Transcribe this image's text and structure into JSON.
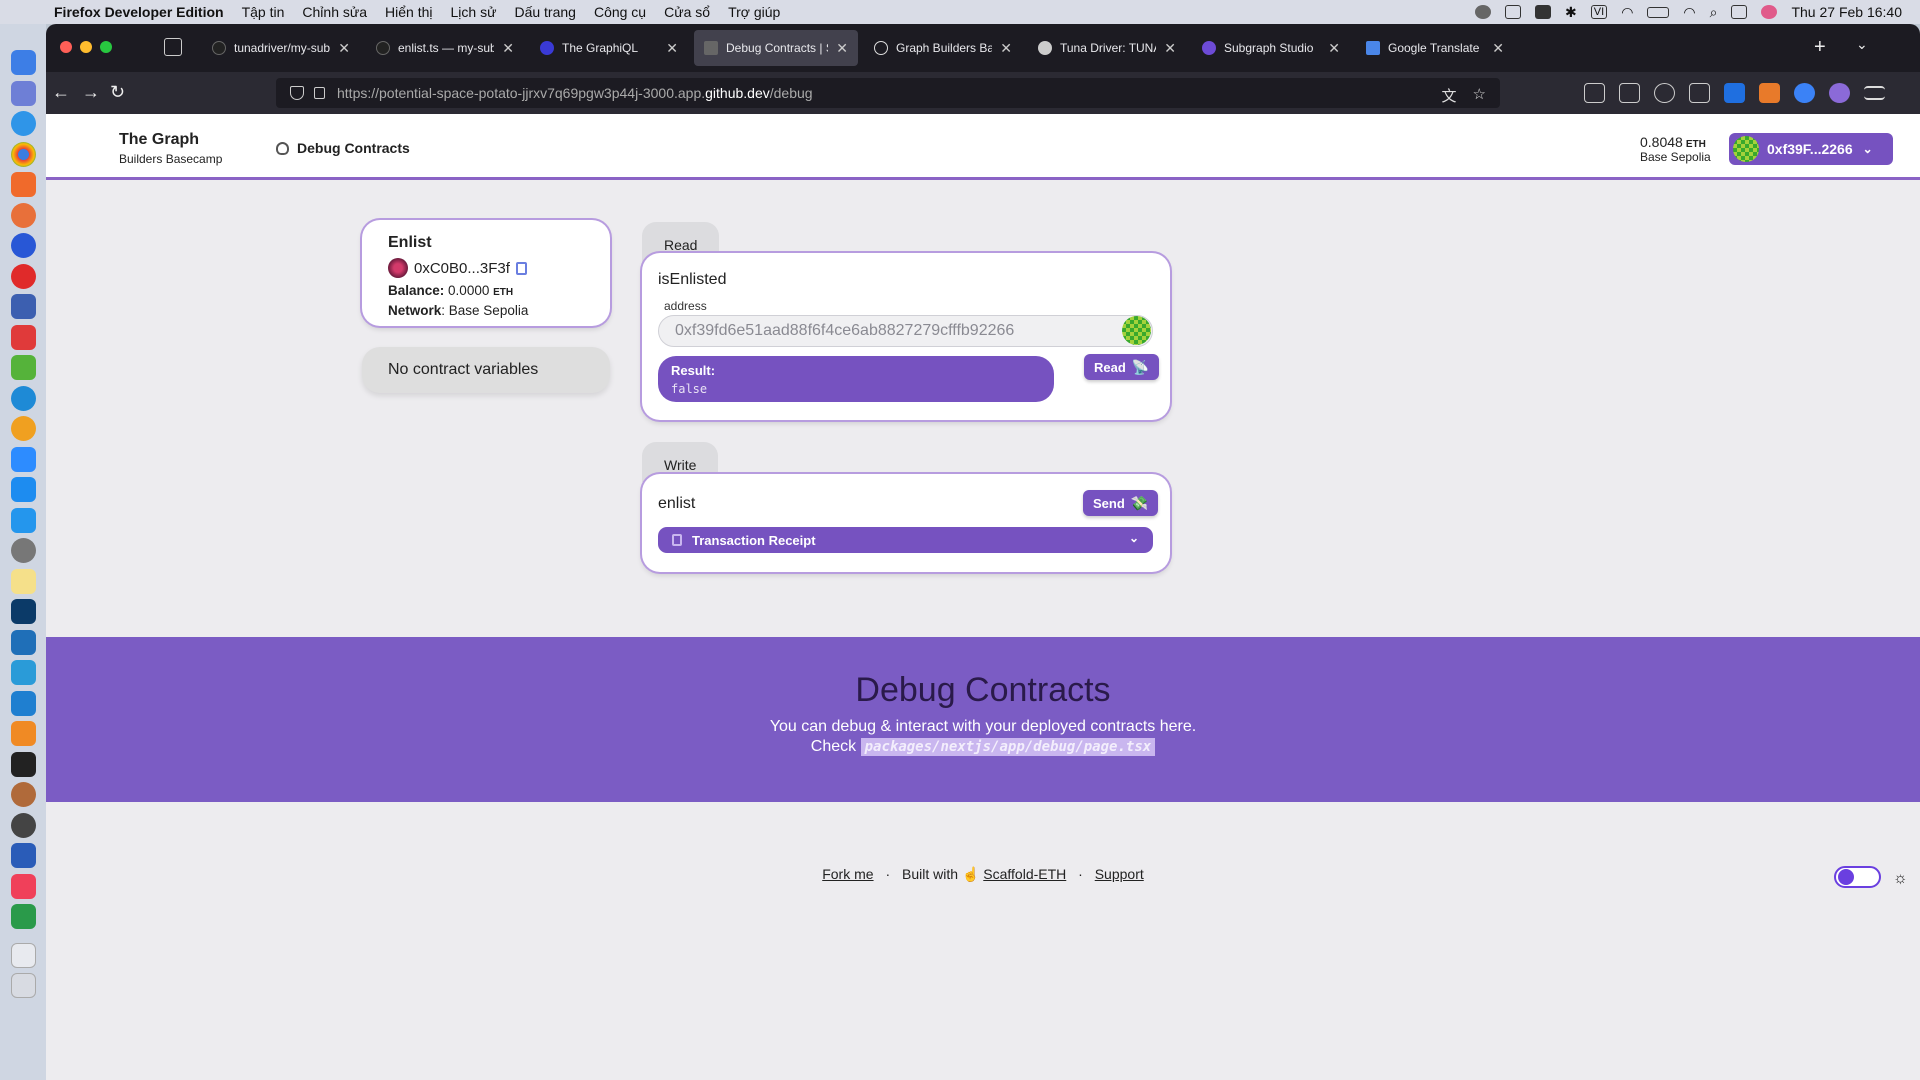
{
  "menubar": {
    "app_name": "Firefox Developer Edition",
    "menus": [
      "Tập tin",
      "Chỉnh sửa",
      "Hiển thị",
      "Lịch sử",
      "Dấu trang",
      "Công cụ",
      "Cửa sổ",
      "Trợ giúp"
    ],
    "datetime": "Thu 27 Feb  16:40",
    "input_source": "VI"
  },
  "tabs": [
    {
      "title": "tunadriver/my-subgraph: T",
      "icon": "github-icon"
    },
    {
      "title": "enlist.ts — my-subgraph [C",
      "icon": "github-icon"
    },
    {
      "title": "The GraphiQL",
      "icon": "graph-icon"
    },
    {
      "title": "Debug Contracts | Scaffold",
      "icon": "scaffold-icon",
      "active": true
    },
    {
      "title": "Graph Builders Basecamp",
      "icon": "graph-icon"
    },
    {
      "title": "Tuna Driver: TUNA Token |",
      "icon": "tuna-icon"
    },
    {
      "title": "Subgraph Studio",
      "icon": "studio-icon"
    },
    {
      "title": "Google Translate",
      "icon": "translate-icon"
    }
  ],
  "url": {
    "prefix": "https://potential-space-potato-jjrxv7q69pgw3p44j-3000.app.",
    "domain": "github.dev",
    "path": "/debug"
  },
  "header": {
    "brand_title": "The Graph",
    "brand_subtitle": "Builders Basecamp",
    "nav_label": "Debug Contracts",
    "balance": "0.8048",
    "balance_unit": "ETH",
    "network": "Base Sepolia",
    "wallet_address": "0xf39F...2266"
  },
  "contract": {
    "name": "Enlist",
    "address": "0xC0B0...3F3f",
    "balance_label": "Balance:",
    "balance_value": "0.0000",
    "balance_unit": "ETH",
    "network_label": "Network",
    "network_value": "Base Sepolia",
    "no_vars": "No contract variables"
  },
  "read": {
    "tab_label": "Read",
    "fn_name": "isEnlisted",
    "param_label": "address",
    "param_value": "0xf39fd6e51aad88f6f4ce6ab8827279cfffb92266",
    "result_label": "Result:",
    "result_value": "false",
    "button_label": "Read",
    "button_emoji": "📡"
  },
  "write": {
    "tab_label": "Write",
    "fn_name": "enlist",
    "button_label": "Send",
    "button_emoji": "💸",
    "receipt_label": "Transaction Receipt"
  },
  "hero": {
    "title": "Debug Contracts",
    "line1": "You can debug & interact with your deployed contracts here.",
    "line2_prefix": "Check",
    "code": "packages/nextjs/app/debug/page.tsx"
  },
  "footer": {
    "fork": "Fork me",
    "built_with": "Built with",
    "scaffold": "Scaffold-ETH",
    "support": "Support"
  },
  "colors": {
    "accent": "#7652c0",
    "hero_bg": "#7b5cc4",
    "page_bg": "#edecef"
  }
}
